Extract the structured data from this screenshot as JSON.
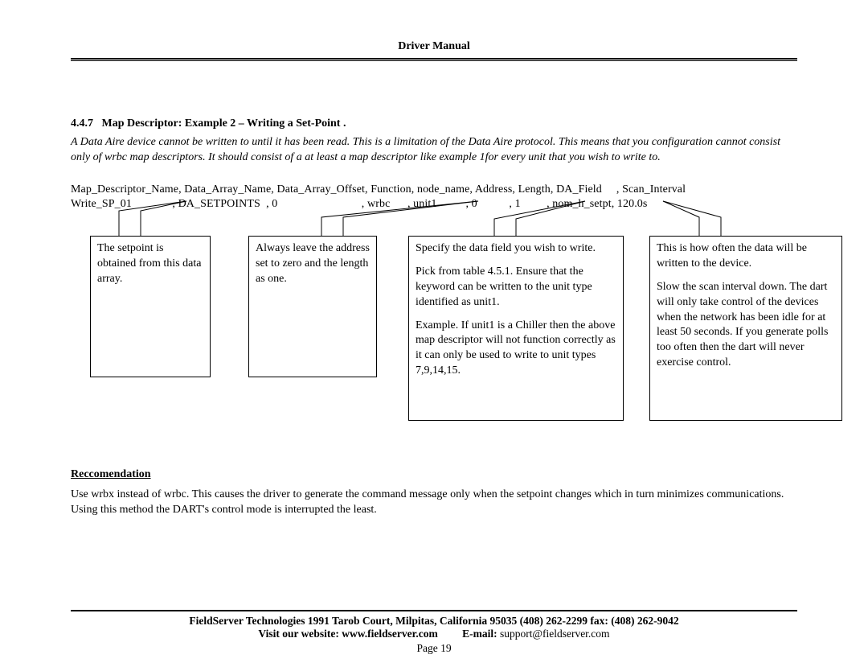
{
  "header": {
    "title": "Driver Manual"
  },
  "section": {
    "number": "4.4.7",
    "heading": "Map Descriptor: Example 2 – Writing a Set-Point .",
    "intro": "A Data Aire device cannot be written to until it has been read. This is a limitation of the Data Aire protocol. This means that you configuration cannot consist only of wrbc map descriptors. It should consist of a at least a map descriptor like example 1for every unit that you wish to write to."
  },
  "data_table": {
    "header_line": "Map_Descriptor_Name, Data_Array_Name, Data_Array_Offset, Function, node_name, Address, Length, DA_Field     , Scan_Interval",
    "value_line": "Write_SP_01              , DA_SETPOINTS  , 0                             , wrbc      , unit1          , 0           , 1         , nom_h_setpt, 120.0s"
  },
  "callouts": {
    "c1": "The setpoint is obtained from this data array.",
    "c2": "Always leave the address set to zero and the length as one.",
    "c3_p1": "Specify the data field you wish to write.",
    "c3_p2": "Pick from table 4.5.1. Ensure that the keyword can be written to the unit type identified as unit1.",
    "c3_p3": "Example. If unit1 is a Chiller then the above map descriptor will not function correctly as it can only be used to write to unit types 7,9,14,15.",
    "c4_p1": "This is how often  the data will be written to the device.",
    "c4_p2": "Slow the scan interval down. The dart will only take control of the devices when the network has been idle for at least 50 seconds. If you generate polls too often then the dart will never exercise control."
  },
  "recommendation": {
    "heading": "Reccomendation",
    "body": "Use wrbx instead of wrbc. This causes the driver to generate the command message only when the setpoint changes which in turn minimizes communications. Using this method the DART's control mode is interrupted the least."
  },
  "footer": {
    "line1": "FieldServer Technologies 1991 Tarob Court, Milpitas, California 95035 (408) 262-2299 fax: (408) 262-9042",
    "visit_label": "Visit our website: ",
    "website": "www.fieldserver.com",
    "email_label": "E-mail:",
    "email": "support@fieldserver.com",
    "page_label": "Page",
    "page_num": "19"
  }
}
